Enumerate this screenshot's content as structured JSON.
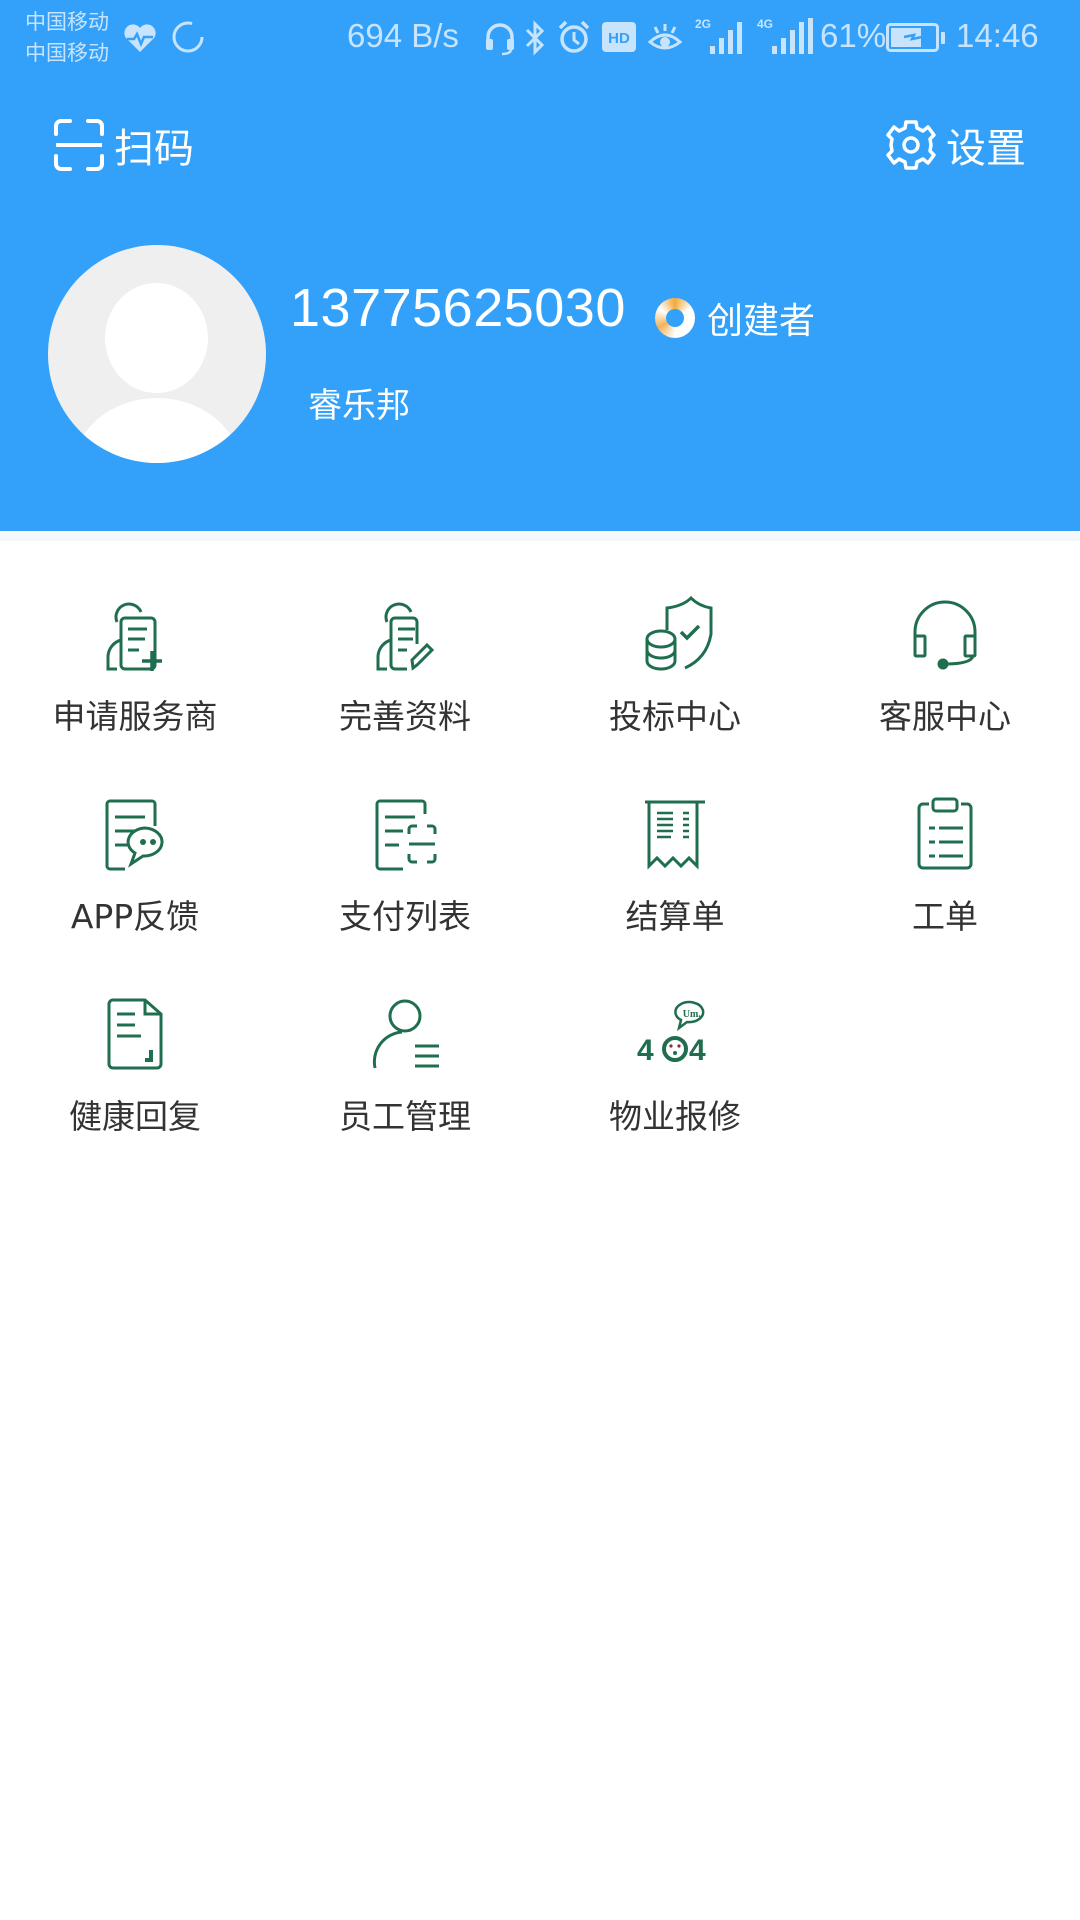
{
  "status_bar": {
    "carrier_1": "中国移动",
    "carrier_2": "中国移动",
    "net_speed": "694 B/s",
    "hd_label": "HD",
    "signal_1_label": "2G",
    "signal_2_label": "4G",
    "battery": "61%",
    "time": "14:46",
    "icons": [
      "heart-rate-icon",
      "loading-ring-icon",
      "headset-icon",
      "bluetooth-icon",
      "alarm-icon",
      "hd-icon",
      "eye-icon",
      "signal-2g-icon",
      "signal-4g-icon",
      "battery-charging-icon"
    ]
  },
  "header": {
    "scan_label": "扫码",
    "settings_label": "设置",
    "background_color": "#33a1fa"
  },
  "profile": {
    "phone": "13775625030",
    "role": "创建者",
    "company": "睿乐邦"
  },
  "menu": {
    "icon_color": "#1f6e4e",
    "items": [
      {
        "label": "申请服务商",
        "icon": "apply-provider-icon"
      },
      {
        "label": "完善资料",
        "icon": "edit-profile-icon"
      },
      {
        "label": "投标中心",
        "icon": "bidding-shield-icon"
      },
      {
        "label": "客服中心",
        "icon": "headset-service-icon"
      },
      {
        "label": "APP反馈",
        "icon": "feedback-chat-icon"
      },
      {
        "label": "支付列表",
        "icon": "payment-list-icon"
      },
      {
        "label": "结算单",
        "icon": "receipt-icon"
      },
      {
        "label": "工单",
        "icon": "clipboard-icon"
      },
      {
        "label": "健康回复",
        "icon": "document-icon"
      },
      {
        "label": "员工管理",
        "icon": "staff-list-icon"
      },
      {
        "label": "物业报修",
        "icon": "404-repair-icon"
      }
    ]
  }
}
